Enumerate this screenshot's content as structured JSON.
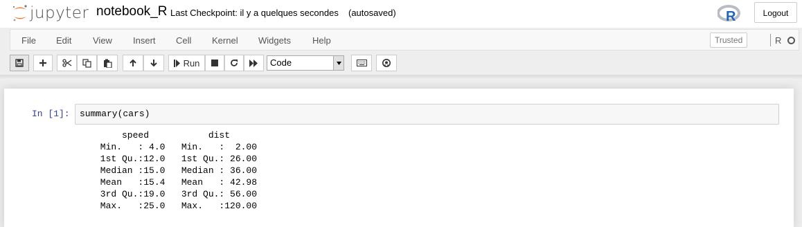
{
  "header": {
    "logo_text": "jupyter",
    "notebook_name": "notebook_R",
    "checkpoint": "Last Checkpoint: il y a quelques secondes",
    "autosave": "(autosaved)",
    "kernel_logo_letter": "R",
    "logout_label": "Logout"
  },
  "menubar": {
    "items": [
      "File",
      "Edit",
      "View",
      "Insert",
      "Cell",
      "Kernel",
      "Widgets",
      "Help"
    ],
    "trusted_label": "Trusted",
    "kernel_name": "R"
  },
  "toolbar": {
    "buttons": [
      {
        "name": "save-button",
        "icon": "floppy-icon"
      },
      {
        "name": "insert-cell-button",
        "icon": "plus-icon"
      },
      {
        "name": "cut-button",
        "icon": "scissors-icon"
      },
      {
        "name": "copy-button",
        "icon": "copy-icon"
      },
      {
        "name": "paste-button",
        "icon": "paste-icon"
      },
      {
        "name": "move-up-button",
        "icon": "arrow-up-icon"
      },
      {
        "name": "move-down-button",
        "icon": "arrow-down-icon"
      },
      {
        "name": "run-button",
        "icon": "step-forward-icon"
      },
      {
        "name": "interrupt-button",
        "icon": "stop-icon"
      },
      {
        "name": "restart-button",
        "icon": "refresh-icon"
      },
      {
        "name": "restart-run-all-button",
        "icon": "fast-forward-icon"
      },
      {
        "name": "command-palette-button",
        "icon": "keyboard-icon"
      },
      {
        "name": "github-button",
        "icon": "github-icon"
      }
    ],
    "run_label": "Run",
    "cell_type": "Code"
  },
  "cell": {
    "prompt": "In [1]:",
    "source": "summary(cars)",
    "output": "     speed           dist       \n Min.   : 4.0   Min.   :  2.00  \n 1st Qu.:12.0   1st Qu.: 26.00  \n Median :15.0   Median : 36.00  \n Mean   :15.4   Mean   : 42.98  \n 3rd Qu.:19.0   3rd Qu.: 56.00  \n Max.   :25.0   Max.   :120.00  "
  },
  "colors": {
    "accent_orange": "#f37726",
    "prompt_blue": "#303f9f",
    "r_logo_blue": "#2165b6"
  }
}
